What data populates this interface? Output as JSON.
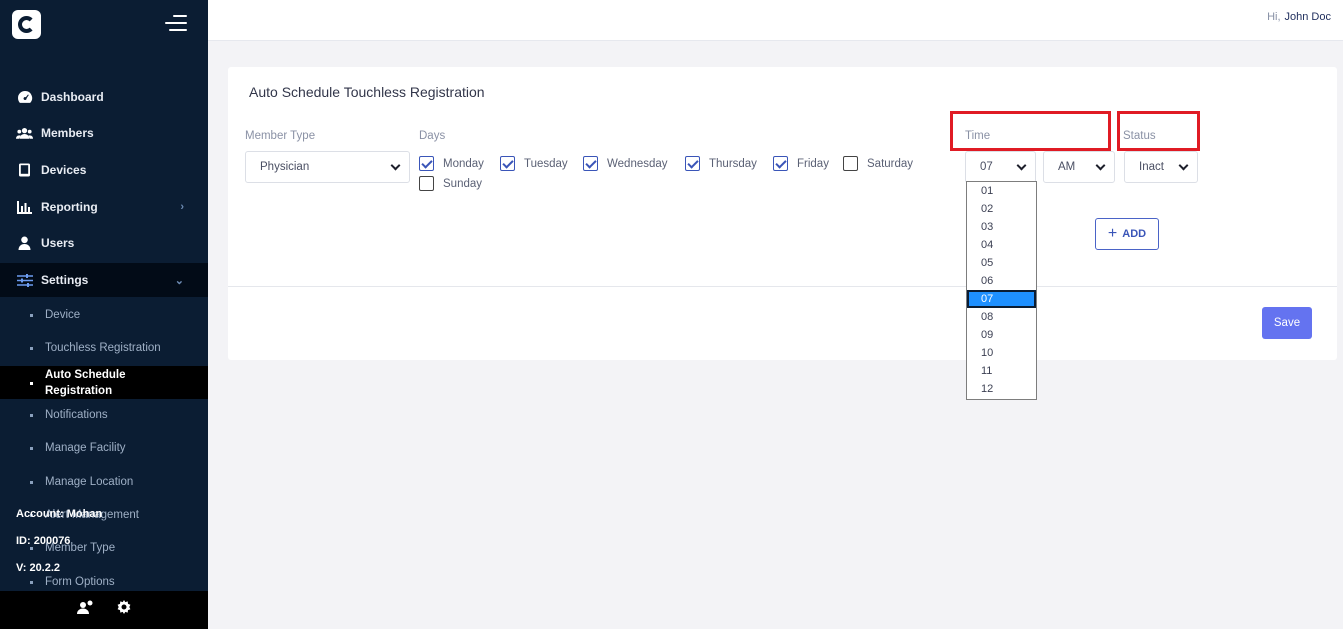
{
  "sidebar": {
    "nav": [
      {
        "label": "Dashboard",
        "icon": "dashboard-icon"
      },
      {
        "label": "Members",
        "icon": "members-icon"
      },
      {
        "label": "Devices",
        "icon": "tablet-icon"
      },
      {
        "label": "Reporting",
        "icon": "chart-icon"
      },
      {
        "label": "Users",
        "icon": "user-icon"
      },
      {
        "label": "Settings",
        "icon": "sliders-icon"
      }
    ],
    "sub": [
      {
        "label": "Device"
      },
      {
        "label": "Touchless Registration"
      },
      {
        "label": "Auto Schedule Registration"
      },
      {
        "label": "Notifications"
      },
      {
        "label": "Manage Facility"
      },
      {
        "label": "Manage Location"
      },
      {
        "label": "Alert Management"
      },
      {
        "label": "Member Type"
      },
      {
        "label": "Form Options"
      }
    ],
    "account": "Account: Mohan",
    "id": "ID: 200076",
    "version": "V: 20.2.2"
  },
  "topbar": {
    "greeting": "Hi,",
    "user": "John Doc"
  },
  "page": {
    "title": "Auto Schedule Touchless Registration",
    "member_type_label": "Member Type",
    "member_type_value": "Physician",
    "days_label": "Days",
    "days": [
      {
        "label": "Monday",
        "checked": true
      },
      {
        "label": "Tuesday",
        "checked": true
      },
      {
        "label": "Wednesday",
        "checked": true
      },
      {
        "label": "Thursday",
        "checked": true
      },
      {
        "label": "Friday",
        "checked": true
      },
      {
        "label": "Saturday",
        "checked": false
      },
      {
        "label": "Sunday",
        "checked": false
      }
    ],
    "time_label": "Time",
    "hour_value": "07",
    "ampm_value": "AM",
    "status_label": "Status",
    "status_value": "Inact",
    "hour_options": [
      "01",
      "02",
      "03",
      "04",
      "05",
      "06",
      "07",
      "08",
      "09",
      "10",
      "11",
      "12"
    ],
    "selected_hour": "07",
    "add_label": "ADD",
    "save_label": "Save"
  },
  "colors": {
    "sidebar": "#0b1d33",
    "accent": "#3a55b8",
    "save": "#6473f0",
    "highlight": "#e01b24",
    "selected_option": "#1e90ff"
  }
}
